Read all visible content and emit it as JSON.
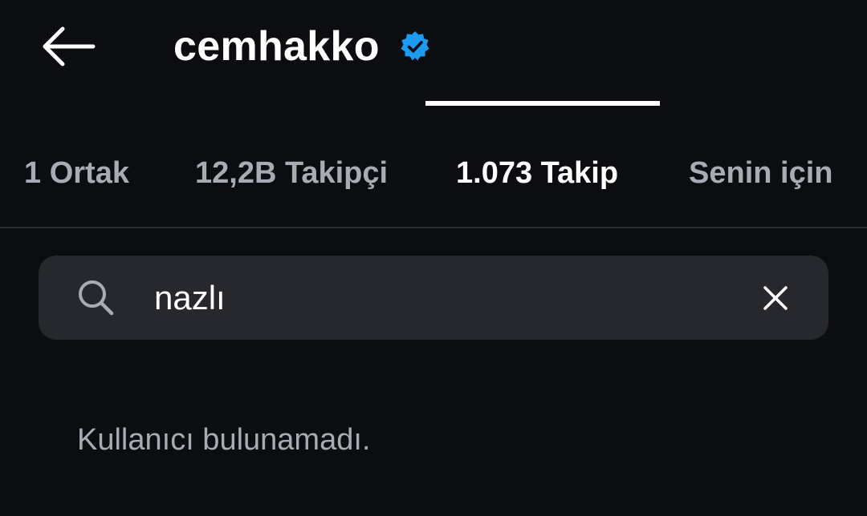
{
  "header": {
    "back_icon": "arrow-left-icon",
    "title": "cemhakko",
    "verified_icon": "verified-badge-icon",
    "verified_color": "#1d9bf0"
  },
  "tabs": [
    {
      "label": "1 Ortak",
      "active": false
    },
    {
      "label": "12,2B Takipçi",
      "active": false
    },
    {
      "label": "1.073 Takip",
      "active": true
    },
    {
      "label": "Senin için",
      "active": false
    }
  ],
  "search": {
    "icon": "search-icon",
    "value": "nazlı",
    "clear_icon": "close-icon"
  },
  "results": {
    "empty_message": "Kullanıcı bulunamadı."
  },
  "colors": {
    "background": "#0c0d10",
    "search_background": "#26282d",
    "text_primary": "#ffffff",
    "text_secondary": "#a8abb3"
  }
}
